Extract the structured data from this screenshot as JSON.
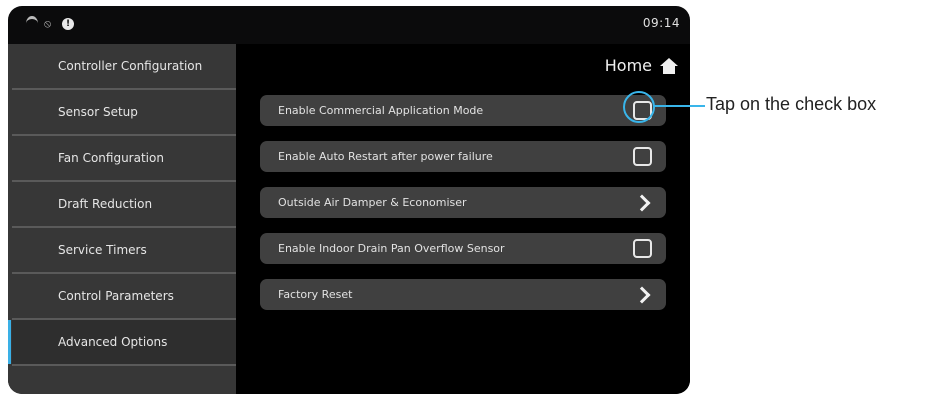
{
  "status_bar": {
    "time": "09:14",
    "icons": [
      "wifi-icon",
      "no-bluetooth-icon",
      "alert-icon"
    ],
    "alert_glyph": "!"
  },
  "header": {
    "title": "Home",
    "icon": "home-icon"
  },
  "sidebar": {
    "items": [
      {
        "label": "Controller Configuration"
      },
      {
        "label": "Sensor Setup"
      },
      {
        "label": "Fan Configuration"
      },
      {
        "label": "Draft Reduction"
      },
      {
        "label": "Service Timers"
      },
      {
        "label": "Control Parameters"
      },
      {
        "label": "Advanced Options",
        "active": true
      }
    ]
  },
  "options": [
    {
      "label": "Enable Commercial Application Mode",
      "control": "checkbox",
      "checked": false
    },
    {
      "label": "Enable Auto Restart after power failure",
      "control": "checkbox",
      "checked": false
    },
    {
      "label": "Outside Air Damper & Economiser",
      "control": "chevron"
    },
    {
      "label": "Enable Indoor Drain Pan Overflow Sensor",
      "control": "checkbox",
      "checked": false
    },
    {
      "label": "Factory Reset",
      "control": "chevron"
    }
  ],
  "annotation": {
    "text": "Tap on the check box",
    "color": "#39b5ea"
  },
  "colors": {
    "accent": "#39b5ea",
    "sidebar_bg": "#373737",
    "main_bg": "#000000"
  }
}
